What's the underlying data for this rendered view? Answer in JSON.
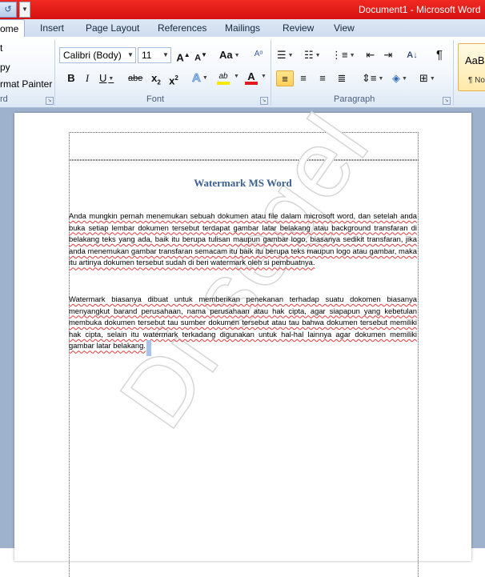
{
  "window": {
    "title": "Document1  -  Microsoft Word"
  },
  "quick_access": {
    "save_icon": "save-icon",
    "customize_icon": "dropdown-arrow"
  },
  "tabs": [
    {
      "label": "ome",
      "active": true
    },
    {
      "label": "Insert"
    },
    {
      "label": "Page Layout"
    },
    {
      "label": "References"
    },
    {
      "label": "Mailings"
    },
    {
      "label": "Review"
    },
    {
      "label": "View"
    }
  ],
  "clipboard": {
    "items": [
      "t",
      "py",
      "rmat Painter"
    ],
    "group_label": "rd"
  },
  "font": {
    "name": "Calibri (Body)",
    "size": "11",
    "group_label": "Font",
    "grow": "A",
    "shrink": "A",
    "case": "Aa",
    "bold": "B",
    "italic": "I",
    "underline": "U",
    "strike": "abe",
    "subscript": "x",
    "superscript": "x",
    "text_effect": "A",
    "highlight": "ab",
    "font_color": "A",
    "highlight_color": "#f6e800",
    "font_color_value": "#e01b1b"
  },
  "paragraph": {
    "group_label": "Paragraph",
    "sort": "A↓",
    "pilcrow": "¶"
  },
  "styles": {
    "preview": "AaBb",
    "name": "¶ No"
  },
  "document": {
    "title": "Watermark MS Word",
    "paragraph1": "Anda mungkin pernah menemukan sebuah dokumen atau file dalam microsoft word, dan setelah anda buka setiap lembar dokumen tersebut terdapat gambar latar belakang atau background transfaran di belakang teks yang ada, baik itu berupa tulisan maupun gambar logo, biasanya sedikit transfaran, jika anda menemukan gambar transfaran semacam itu baik itu berupa teks maupun logo atau gambar, maka itu artinya dokumen tersebut sudah di beri watermark oleh si pembuatnya.",
    "paragraph2": "Watermark biasanya dibuat  untuk memberikan penekanan terhadap suatu dokomen biasanya menyangkut barand perusahaan, nama perusahaan atau hak cipta, agar siapapun yang kebetulan membuka dokumen tersebut tau sumber dokumen tersebut atau tau bahwa dokumen tersebut memiliki hak cipta, selain itu watermark terkadang digunakan untuk hal-hal lainnya agar dokumen memiliki gambar latar belakang.",
    "watermark": "Di segel"
  }
}
